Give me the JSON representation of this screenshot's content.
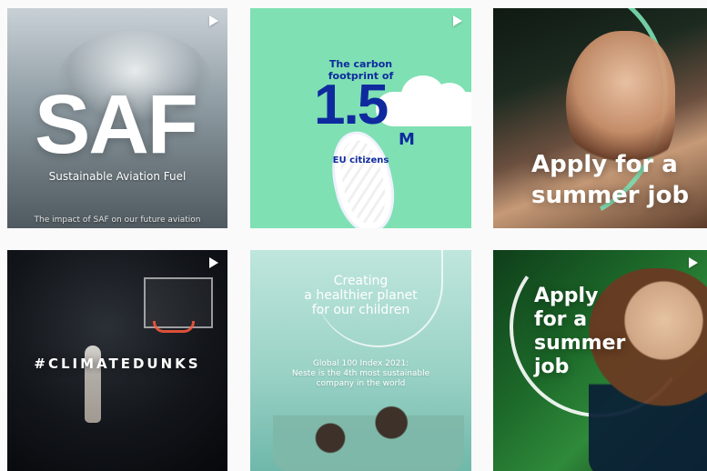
{
  "tiles": [
    {
      "id": "saf",
      "has_play_icon": true,
      "headline": "SAF",
      "subtitle": "Sustainable Aviation Fuel",
      "caption": "The impact of SAF on our future aviation"
    },
    {
      "id": "carbon",
      "has_play_icon": true,
      "top_text": "The carbon\nfootprint of",
      "big_number": "1.5",
      "big_suffix": "M",
      "bottom_text": "EU citizens"
    },
    {
      "id": "apply1",
      "has_play_icon": false,
      "headline": "Apply for a\nsummer job"
    },
    {
      "id": "climatedunks",
      "has_play_icon": true,
      "headline": "#CLIMATEDUNKS"
    },
    {
      "id": "healthier-planet",
      "has_play_icon": false,
      "title": "Creating\na healthier planet\nfor our children",
      "body": "Global 100 Index 2021:\nNeste is the 4th most sustainable\ncompany in the world"
    },
    {
      "id": "apply2",
      "has_play_icon": true,
      "headline": "Apply\nfor a\nsummer\njob"
    }
  ],
  "colors": {
    "mint": "#7fe0b3",
    "navy": "#0f2a9e",
    "white": "#ffffff",
    "page_bg": "#fafafa"
  },
  "icons": {
    "play": "play-icon"
  }
}
